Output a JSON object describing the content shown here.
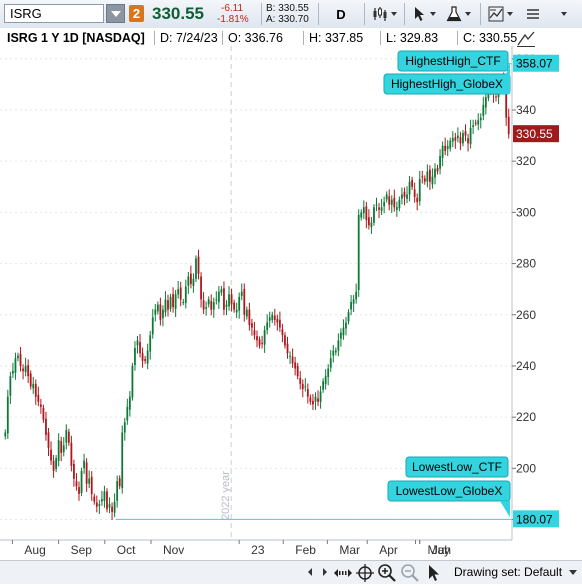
{
  "toolbar": {
    "symbol": "ISRG",
    "link_number": "2",
    "last_price": "330.55",
    "net_change": "-6.11",
    "net_change_pct": "-1.81%",
    "bid": "B: 330.55",
    "ask": "A: 330.70",
    "period": "D"
  },
  "header": {
    "symbol_desc": "ISRG 1 Y 1D [NASDAQ]",
    "date": "D: 7/24/23",
    "open": "O: 336.76",
    "high": "H: 337.85",
    "low": "L: 329.83",
    "close": "C: 330.55"
  },
  "bottom_bar": {
    "drawing_set": "Drawing set: Default"
  },
  "colors": {
    "up": "#0c7a36",
    "down": "#b0161b",
    "label_bg": "#33d4e0",
    "price_tag": "#9e1b1b"
  },
  "chart_data": {
    "type": "candlestick",
    "symbol": "ISRG",
    "ylim": [
      172,
      365
    ],
    "y_ticks": [
      180,
      200,
      220,
      240,
      260,
      280,
      300,
      320,
      340,
      360
    ],
    "x_tick_labels": [
      "Aug",
      "Sep",
      "Oct",
      "Nov",
      "23",
      "Feb",
      "Mar",
      "Apr",
      "May",
      "Jun",
      "Jul"
    ],
    "year_marker": "2022 year",
    "current_price": 330.55,
    "highest_high": 358.07,
    "lowest_low": 180.07,
    "price_labels": [
      "358.07",
      "330.55",
      "180.07"
    ],
    "bubbles": [
      "HighestHigh_CTF",
      "HighestHigh_GlobeX",
      "LowestLow_CTF",
      "LowestLow_GlobeX"
    ],
    "closes": [
      214,
      228,
      236,
      238,
      243,
      244,
      240,
      238,
      240,
      236,
      232,
      233,
      228,
      226,
      224,
      219,
      213,
      208,
      203,
      199,
      204,
      211,
      206,
      209,
      215,
      210,
      201,
      196,
      193,
      190,
      199,
      203,
      194,
      196,
      190,
      187,
      185,
      186,
      188,
      191,
      184,
      186,
      183,
      187,
      195,
      193,
      214,
      218,
      224,
      228,
      240,
      247,
      250,
      245,
      242,
      242,
      246,
      252,
      259,
      262,
      264,
      258,
      262,
      266,
      262,
      267,
      263,
      268,
      270,
      266,
      265,
      271,
      275,
      272,
      274,
      282,
      276,
      266,
      262,
      263,
      266,
      262,
      265,
      266,
      269,
      270,
      262,
      264,
      268,
      264,
      262,
      262,
      267,
      269,
      260,
      262,
      256,
      255,
      252,
      250,
      248,
      249,
      254,
      257,
      259,
      260,
      258,
      257,
      255,
      252,
      248,
      245,
      244,
      241,
      239,
      236,
      233,
      231,
      232,
      228,
      226,
      225,
      228,
      226,
      230,
      234,
      236,
      239,
      243,
      246,
      246,
      250,
      253,
      255,
      257,
      261,
      265,
      266,
      269,
      299,
      300,
      302,
      297,
      295,
      296,
      302,
      303,
      301,
      302,
      304,
      307,
      303,
      305,
      302,
      302,
      305,
      307,
      306,
      307,
      312,
      310,
      306,
      304,
      313,
      314,
      312,
      316,
      312,
      314,
      317,
      316,
      322,
      326,
      324,
      326,
      328,
      329,
      328,
      330,
      327,
      331,
      330,
      327,
      333,
      334,
      335,
      336,
      337,
      342,
      345,
      349,
      348,
      346,
      345,
      352,
      353,
      351,
      337,
      330.55
    ]
  }
}
